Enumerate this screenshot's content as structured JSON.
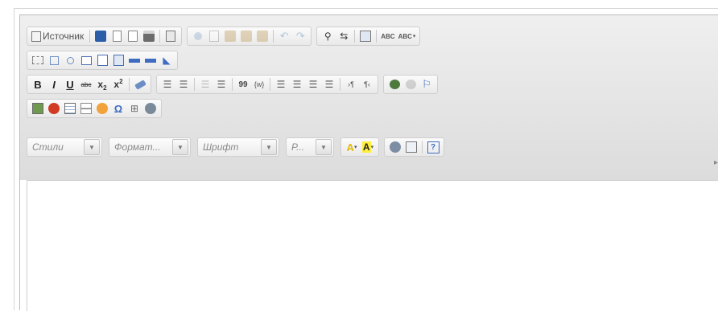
{
  "toolbar": {
    "source_label": "Источник",
    "styles_label": "Стили",
    "format_label": "Формат...",
    "font_label": "Шрифт",
    "size_label": "Р...",
    "spell_label_1": "ABC",
    "spell_label_2": "ABC",
    "subscript": "x",
    "sub_mark": "2",
    "superscript": "x",
    "sup_mark": "2",
    "bold": "B",
    "italic": "I",
    "underline": "U",
    "strike": "abc",
    "quote": "99",
    "omega": "Ω",
    "help": "?",
    "text_color": "A",
    "bg_color": "A"
  },
  "colors": {
    "toolbar_bg": "#dcdcdc",
    "accent_blue": "#2f5fa8",
    "text_color_yellow": "#f2d000",
    "bg_color_yellow": "#ffef3a"
  }
}
